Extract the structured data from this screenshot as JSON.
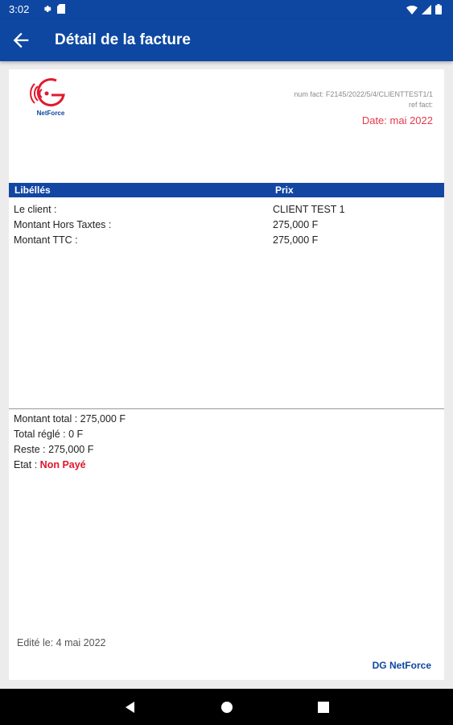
{
  "status_bar": {
    "time": "3:02"
  },
  "app_bar": {
    "title": "Détail de la facture"
  },
  "invoice": {
    "brand_name": "NetForce",
    "num_fact": "num fact: F2145/2022/5/4/CLIENTTEST1/1",
    "ref_fact": "ref fact:",
    "date": "Date: mai 2022"
  },
  "table": {
    "headers": [
      "Libéllés",
      "Prix"
    ],
    "rows": [
      {
        "label": "Le client  :",
        "value": "CLIENT TEST 1"
      },
      {
        "label": "Montant Hors Taxtes  :",
        "value": "275,000 F"
      },
      {
        "label": "Montant TTC  :",
        "value": "275,000 F"
      }
    ]
  },
  "summary": {
    "montant_total": "Montant total  : 275,000 F",
    "total_regle": "Total réglé  : 0 F",
    "reste": "Reste  : 275,000 F",
    "etat_label": "Etat  :",
    "etat_value": "Non Payé"
  },
  "footer": {
    "edited": "Edité le: 4 mai 2022",
    "signature": "DG NetForce"
  },
  "colors": {
    "primary": "#0d47a1",
    "table_header": "#1346a3",
    "date_red": "#e5394b",
    "status_red": "#e0162b"
  }
}
